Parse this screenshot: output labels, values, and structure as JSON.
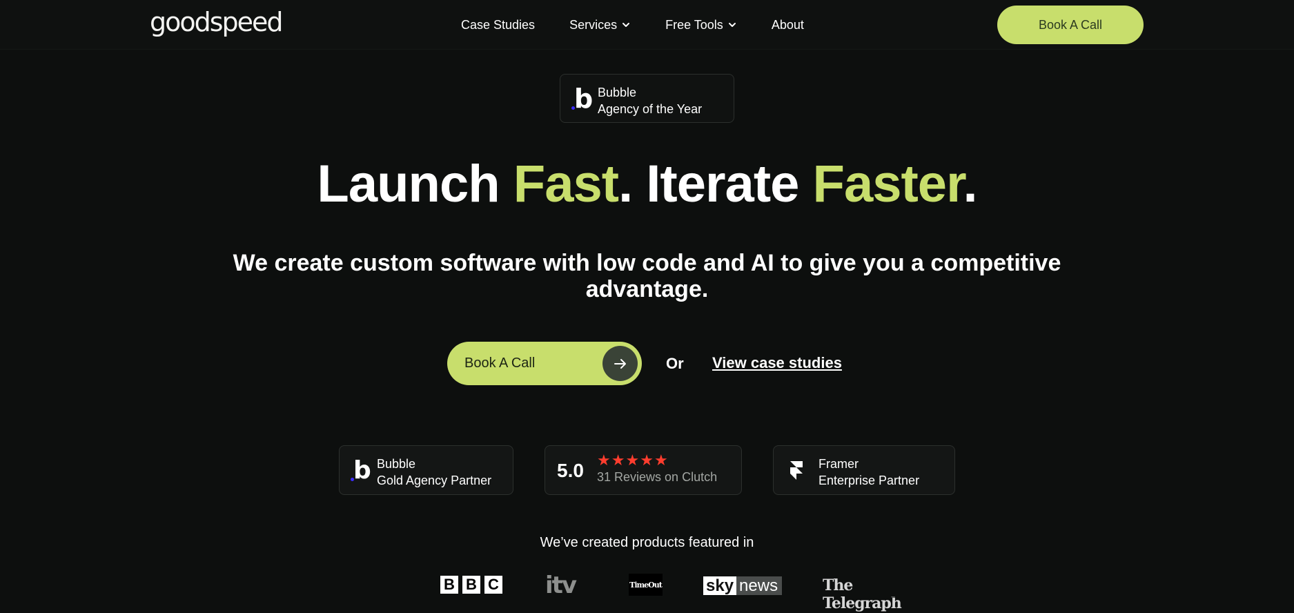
{
  "header": {
    "logo": "goodspeed",
    "nav": [
      {
        "label": "Case Studies"
      },
      {
        "label": "Services",
        "icon": "chevron-down-icon"
      },
      {
        "label": "Free Tools",
        "icon": "chevron-down-icon"
      },
      {
        "label": "About"
      }
    ],
    "cta_label": "Book A Call"
  },
  "award": {
    "icon": "bubble-logo-icon",
    "line1": "Bubble",
    "line2": "Agency of the Year"
  },
  "hero": {
    "headline_w1": "Launch ",
    "headline_w2": "Fast",
    "headline_w3": ". Iterate ",
    "headline_w4": "Faster",
    "headline_w5": ".",
    "subheading": "We create custom software with low code and AI to give you a competitive advantage.",
    "cta_label": "Book A Call",
    "cta_icon": "arrow-right-icon",
    "or_text": "Or",
    "secondary_link": "View case studies"
  },
  "trust": {
    "bubble": {
      "icon": "bubble-logo-icon",
      "line1": "Bubble",
      "line2": "Gold Agency Partner"
    },
    "clutch": {
      "rating": "5.0",
      "stars": 5,
      "reviews": "31 Reviews on Clutch"
    },
    "framer": {
      "icon": "framer-logo-icon",
      "line1": "Framer",
      "line2": "Enterprise Partner"
    }
  },
  "featured": {
    "title": "We’ve created products featured in",
    "logos": {
      "bbc": [
        "B",
        "B",
        "C"
      ],
      "itv": "itv",
      "timeout": "TimeOut",
      "sky": "sky",
      "news": "news",
      "telegraph": "The Telegraph"
    }
  },
  "colors": {
    "background": "#0d0f0e",
    "accent": "#c8de6c",
    "star": "#ff3d2e"
  }
}
